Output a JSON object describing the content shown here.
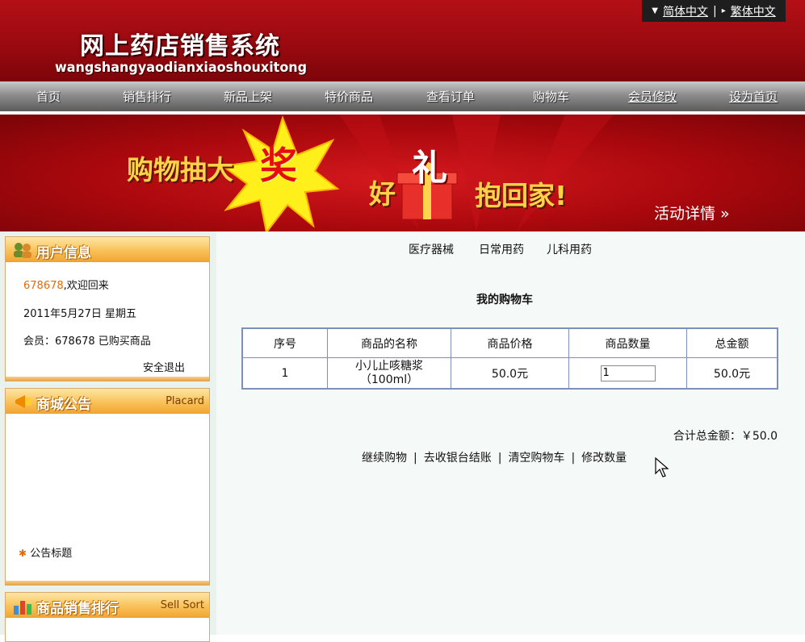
{
  "header": {
    "title": "网上药店销售系统",
    "subtitle": "wangshangyaodianxiaoshouxitong",
    "lang": {
      "simplified": "简体中文",
      "divider": "|",
      "traditional": "繁体中文"
    }
  },
  "nav": [
    {
      "key": "home",
      "label": "首页"
    },
    {
      "key": "ranking",
      "label": "销售排行"
    },
    {
      "key": "new",
      "label": "新品上架"
    },
    {
      "key": "special",
      "label": "特价商品"
    },
    {
      "key": "orders",
      "label": "查看订单"
    },
    {
      "key": "cart",
      "label": "购物车"
    },
    {
      "key": "member",
      "label": "会员修改"
    },
    {
      "key": "sethome",
      "label": "设为首页"
    }
  ],
  "banner": {
    "lucky": "购物抽大",
    "prize": "奖",
    "hao": "好",
    "li": "礼",
    "home": "抱回家!",
    "detail": "活动详情 »"
  },
  "sidebar": {
    "user": {
      "title": "用户信息",
      "username": "678678",
      "welcome": ",欢迎回来",
      "date": "2011年5月27日  星期五",
      "member_line": "会员：678678  已购买商品",
      "logout": "安全退出"
    },
    "placard": {
      "title": "商城公告",
      "subtitle": "Placard",
      "items": [
        "公告标题"
      ]
    },
    "sales": {
      "title": "商品销售排行",
      "subtitle": "Sell Sort"
    }
  },
  "categories": [
    "医疗器械",
    "日常用药",
    "儿科用药"
  ],
  "cart": {
    "title": "我的购物车",
    "headers": [
      "序号",
      "商品的名称",
      "商品价格",
      "商品数量",
      "总金额"
    ],
    "rows": [
      {
        "no": "1",
        "name": "小儿止咳糖浆",
        "spec": "（100ml）",
        "price": "50.0元",
        "qty": "1",
        "total": "50.0元"
      }
    ],
    "total_label": "合计总金额：￥50.0",
    "actions": [
      "继续购物",
      "去收银台结账",
      "清空购物车",
      "修改数量"
    ]
  },
  "colors": {
    "header_red": "#9a0a10",
    "nav_gray": "#8d8d8d",
    "panel_orange": "#f9c25a",
    "table_border": "#7d8fbd",
    "username_orange": "#e86a00"
  }
}
